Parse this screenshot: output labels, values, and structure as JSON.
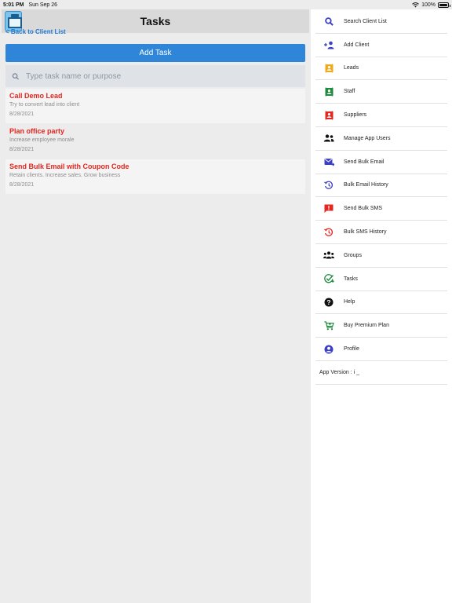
{
  "status_bar": {
    "time": "5:01 PM",
    "date": "Sun Sep 26",
    "battery": "100%",
    "battery_level": 1.0
  },
  "header": {
    "title": "Tasks"
  },
  "back_link": "< Back to Client List",
  "add_task_label": "Add Task",
  "search": {
    "placeholder": "Type task name or purpose",
    "value": ""
  },
  "tasks": [
    {
      "title": "Call Demo Lead",
      "purpose": "Try to convert lead into client",
      "date": "8/28/2021"
    },
    {
      "title": "Plan office party",
      "purpose": "Increase employee morale",
      "date": "8/28/2021"
    },
    {
      "title": "Send Bulk Email with Coupon Code",
      "purpose": "Retain clients. Increase sales. Grow business",
      "date": "8/28/2021"
    }
  ],
  "menu": {
    "items": [
      {
        "label": "Search Client List",
        "icon": "search-icon",
        "color": "#3b40c4"
      },
      {
        "label": "Add Client",
        "icon": "add-user-icon",
        "color": "#3b40c4"
      },
      {
        "label": "Leads",
        "icon": "contact-card-icon",
        "color": "#f0a81c"
      },
      {
        "label": "Staff",
        "icon": "contact-card-icon",
        "color": "#1e8a3e"
      },
      {
        "label": "Suppliers",
        "icon": "contact-card-icon",
        "color": "#e3261f"
      },
      {
        "label": "Manage App Users",
        "icon": "users-icon",
        "color": "#111111"
      },
      {
        "label": "Send Bulk Email",
        "icon": "mail-icon",
        "color": "#3b40c4"
      },
      {
        "label": "Bulk Email History",
        "icon": "history-icon",
        "color": "#3b40c4"
      },
      {
        "label": "Send Bulk SMS",
        "icon": "sms-icon",
        "color": "#e3261f"
      },
      {
        "label": "Bulk SMS History",
        "icon": "history-icon",
        "color": "#e3261f"
      },
      {
        "label": "Groups",
        "icon": "group-icon",
        "color": "#111111"
      },
      {
        "label": "Tasks",
        "icon": "tasks-check-icon",
        "color": "#1e8a3e"
      },
      {
        "label": "Help",
        "icon": "help-icon",
        "color": "#111111"
      },
      {
        "label": "Buy Premium Plan",
        "icon": "cart-icon",
        "color": "#1e8a3e"
      },
      {
        "label": "Profile",
        "icon": "profile-icon",
        "color": "#3b40c4"
      }
    ],
    "app_version": "App Version : i _"
  }
}
